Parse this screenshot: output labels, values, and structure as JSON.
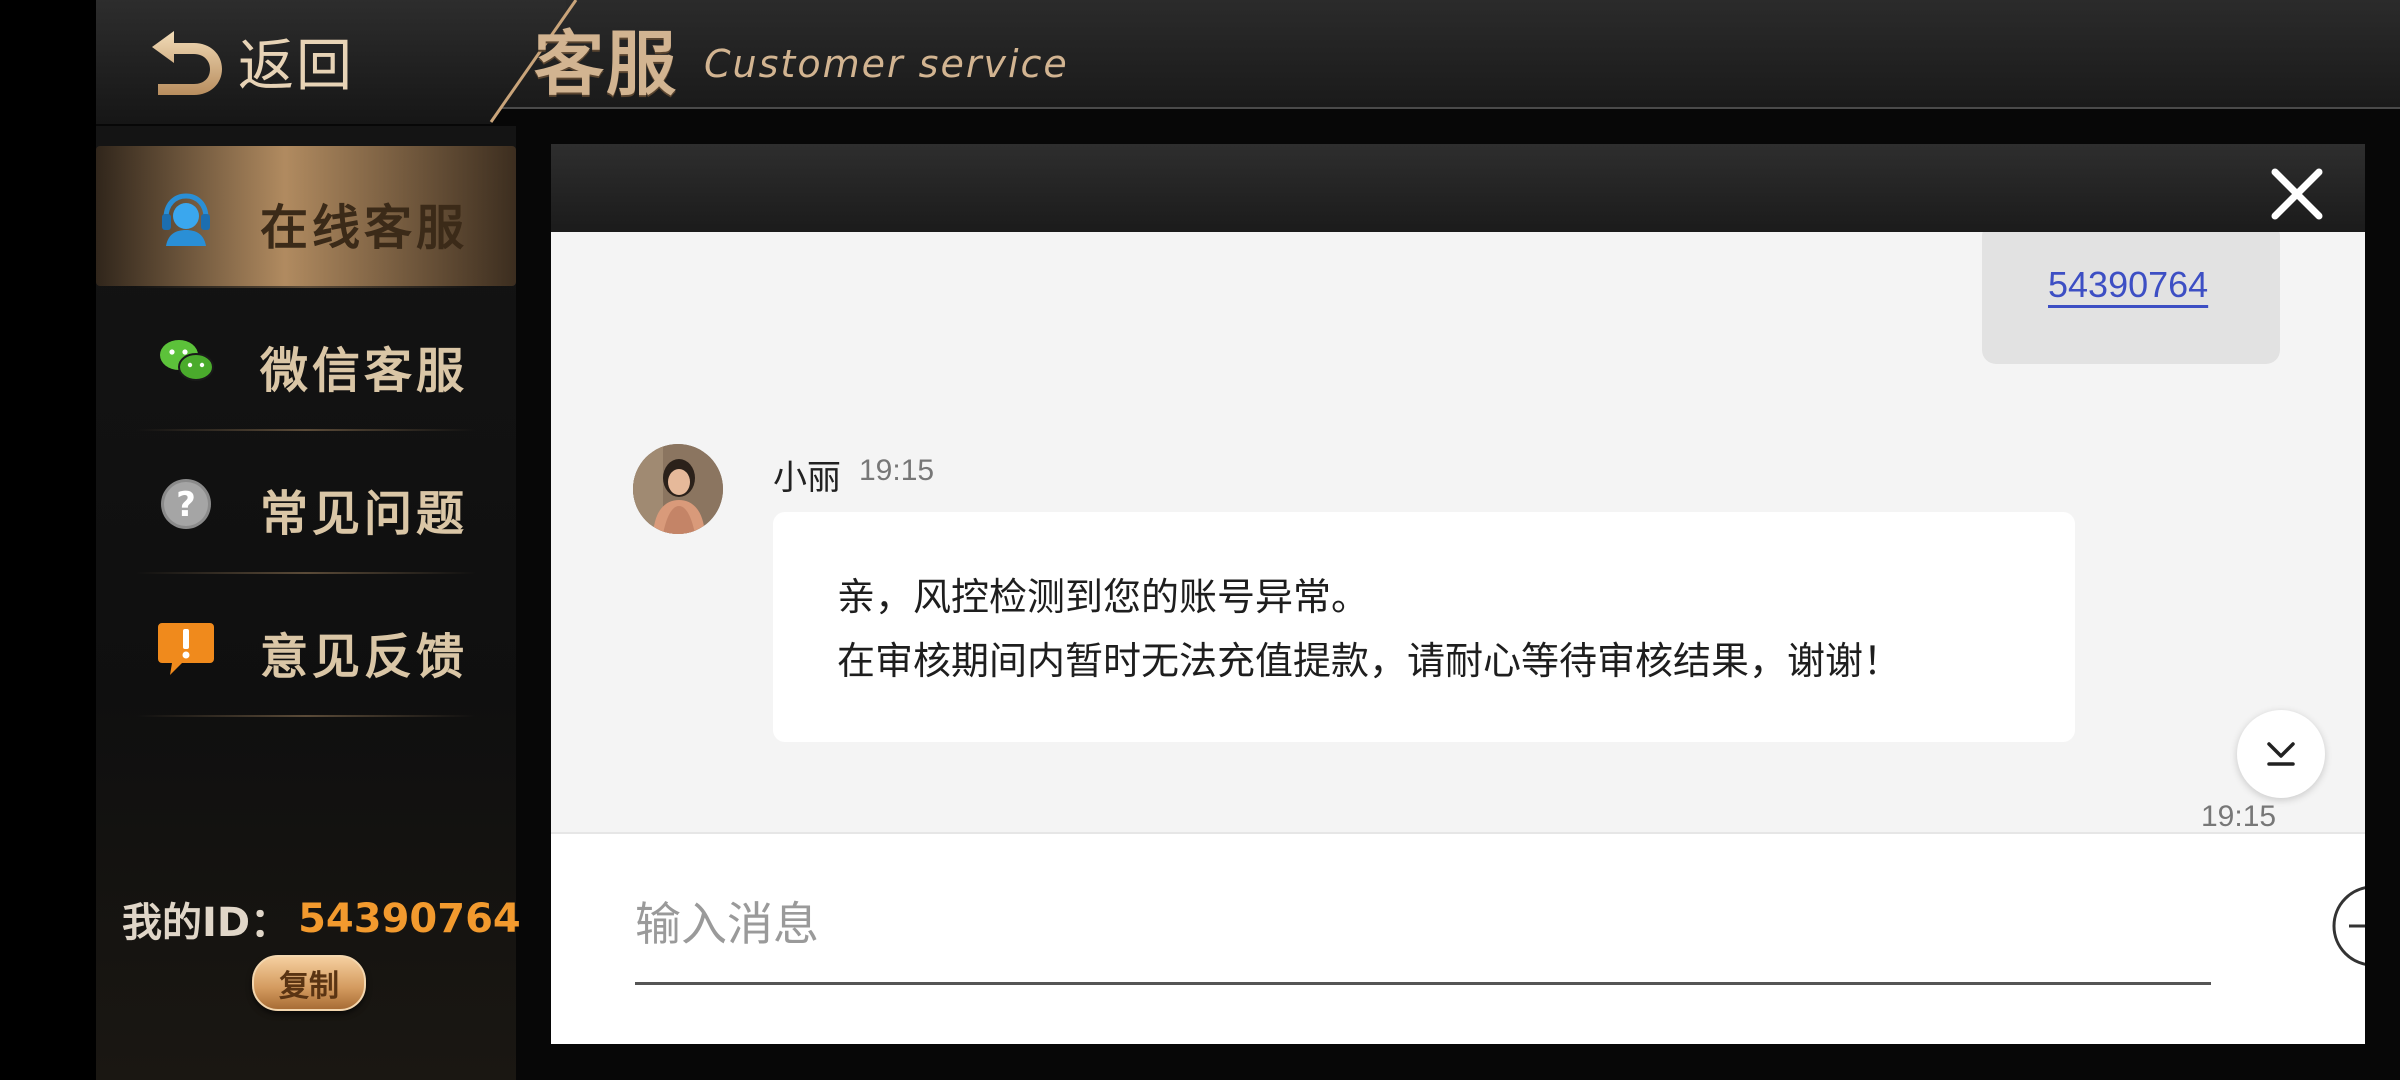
{
  "header": {
    "back_label": "返回",
    "title_cn": "客服",
    "title_en": "Customer service"
  },
  "sidebar": {
    "items": [
      {
        "label": "在线客服",
        "icon": "headset-icon",
        "active": true
      },
      {
        "label": "微信客服",
        "icon": "wechat-icon",
        "active": false
      },
      {
        "label": "常见问题",
        "icon": "question-icon",
        "active": false
      },
      {
        "label": "意见反馈",
        "icon": "feedback-icon",
        "active": false
      }
    ],
    "id_label": "我的ID：",
    "id_value": "54390764",
    "copy_label": "复制"
  },
  "chat": {
    "own_message": "54390764",
    "agent_name": "小丽",
    "agent_time": "19:15",
    "agent_message_lines": [
      "亲，风控检测到您的账号异常。",
      "在审核期间内暂时无法充值提款，请耐心等待审核结果，谢谢！"
    ],
    "bottom_time": "19:15",
    "input_placeholder": "输入消息"
  },
  "colors": {
    "accent_gold": "#d2b491",
    "id_orange": "#f29a2e",
    "link_blue": "#3d4fc4"
  }
}
